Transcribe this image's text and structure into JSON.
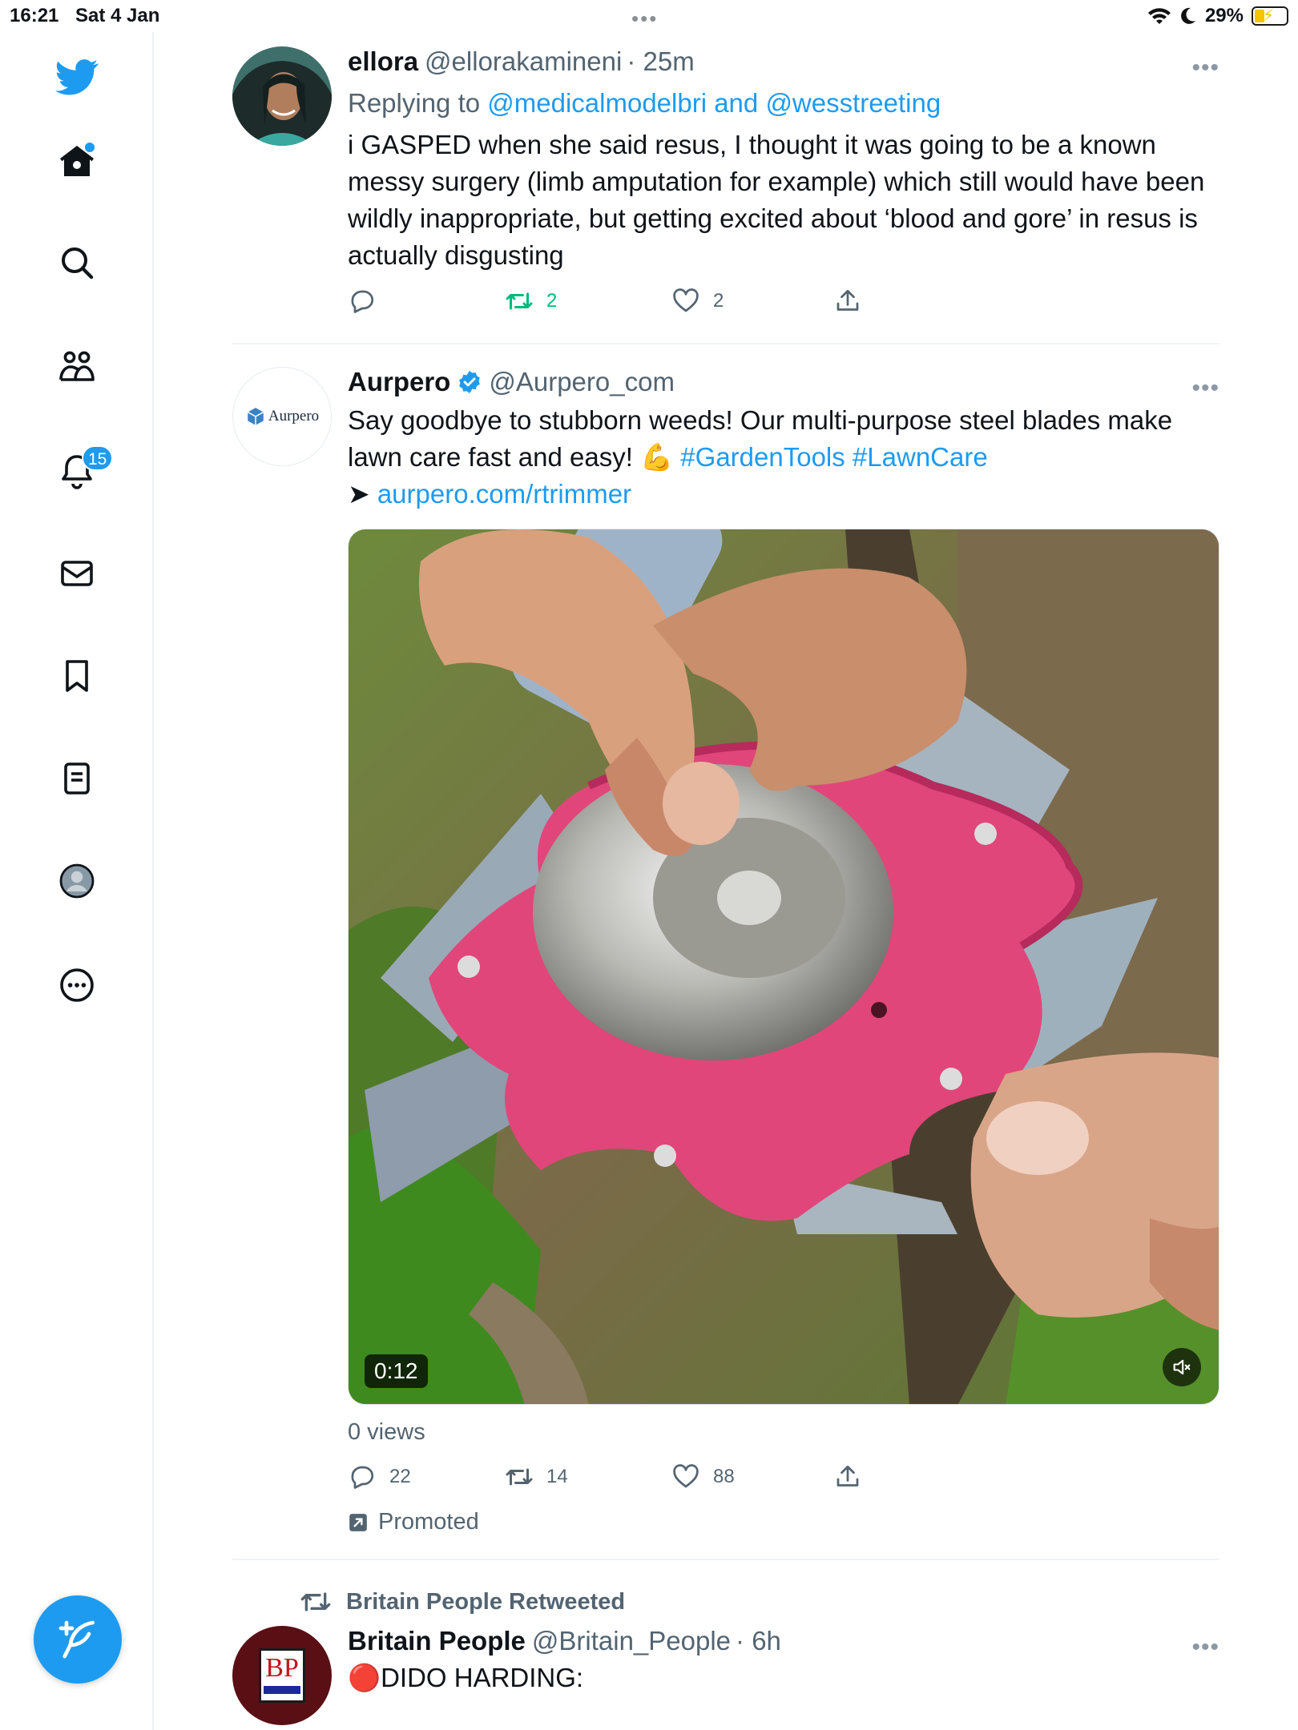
{
  "status_bar": {
    "time": "16:21",
    "date": "Sat 4 Jan",
    "battery": "29%"
  },
  "sidebar": {
    "notifications_badge": "15",
    "items": [
      "twitter-logo",
      "home-icon",
      "search-icon",
      "communities-icon",
      "notifications-icon",
      "messages-icon",
      "bookmarks-icon",
      "lists-icon",
      "profile-icon",
      "more-icon"
    ]
  },
  "tweets": [
    {
      "name": "ellora",
      "handle": "@ellorakamineni",
      "time": "· 25m",
      "replying_prefix": "Replying to ",
      "replying_to_1": "@medicalmodelbri",
      "replying_and": " and ",
      "replying_to_2": "@wesstreeting",
      "text": "i GASPED when she said resus, I thought it was going to be a known messy surgery (limb amputation for example) which still would have been wildly inappropriate, but getting excited about ‘blood and gore’ in resus is actually disgusting",
      "replies": "",
      "retweets": "2",
      "likes": "2"
    },
    {
      "name": "Aurpero",
      "handle": "@Aurpero_com",
      "avatar_text": "Aurpero",
      "text_line1": "Say goodbye to stubborn weeds! Our multi-purpose steel blades make lawn care fast and easy! 💪 ",
      "hashtags": "#GardenTools #LawnCare",
      "arrow": "➤ ",
      "link": "aurpero.com/rtrimmer",
      "video_duration": "0:12",
      "views": "0 views",
      "replies": "22",
      "retweets": "14",
      "likes": "88",
      "promoted": "Promoted"
    },
    {
      "retweeted_by": "Britain People Retweeted",
      "name": "Britain People",
      "handle": "@Britain_People",
      "time": "· 6h",
      "avatar_text": "BP",
      "text": "🔴DIDO HARDING:"
    }
  ],
  "colors": {
    "accent": "#1d9bf0",
    "retweet_green": "#00ba7c",
    "secondary_text": "#536471"
  }
}
